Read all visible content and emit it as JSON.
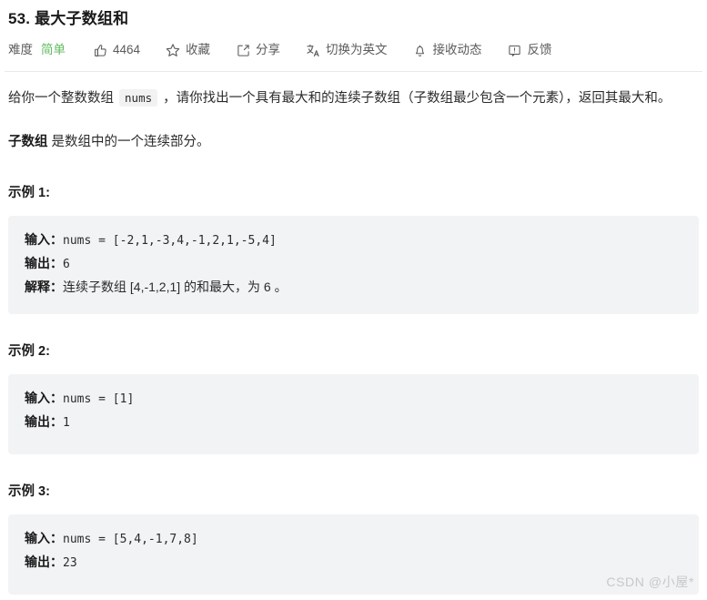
{
  "header": {
    "problem_number": "53.",
    "problem_name": "最大子数组和",
    "full_title": "53. 最大子数组和"
  },
  "toolbar": {
    "difficulty_label": "难度",
    "difficulty_value": "简单",
    "difficulty_color": "#5eb95e",
    "like_count": "4464",
    "like_icon": "thumbs-up-icon",
    "favorite_label": "收藏",
    "favorite_icon": "star-icon",
    "share_label": "分享",
    "share_icon": "share-icon",
    "translate_label": "切换为英文",
    "translate_icon": "translate-icon",
    "subscribe_label": "接收动态",
    "subscribe_icon": "bell-icon",
    "feedback_label": "反馈",
    "feedback_icon": "feedback-icon"
  },
  "description": {
    "para1_before_code": "给你一个整数数组 ",
    "para1_code": "nums",
    "para1_after_code": " ，请你找出一个具有最大和的连续子数组（子数组最少包含一个元素），返回其最大和。",
    "para2_strong": "子数组",
    "para2_rest": " 是数组中的一个连续部分。"
  },
  "examples": [
    {
      "heading": "示例 1:",
      "lines": [
        {
          "label": "输入：",
          "value": "nums = [-2,1,-3,4,-1,2,1,-5,4]",
          "type": "code"
        },
        {
          "label": "输出：",
          "value": "6",
          "type": "code"
        },
        {
          "label": "解释：",
          "value": "连续子数组 [4,-1,2,1] 的和最大，为 6 。",
          "type": "text"
        }
      ]
    },
    {
      "heading": "示例 2:",
      "lines": [
        {
          "label": "输入：",
          "value": "nums = [1]",
          "type": "code"
        },
        {
          "label": "输出：",
          "value": "1",
          "type": "code"
        }
      ]
    },
    {
      "heading": "示例 3:",
      "lines": [
        {
          "label": "输入：",
          "value": "nums = [5,4,-1,7,8]",
          "type": "code"
        },
        {
          "label": "输出：",
          "value": "23",
          "type": "code"
        }
      ]
    }
  ],
  "watermark": {
    "text": "CSDN @小屋*"
  }
}
